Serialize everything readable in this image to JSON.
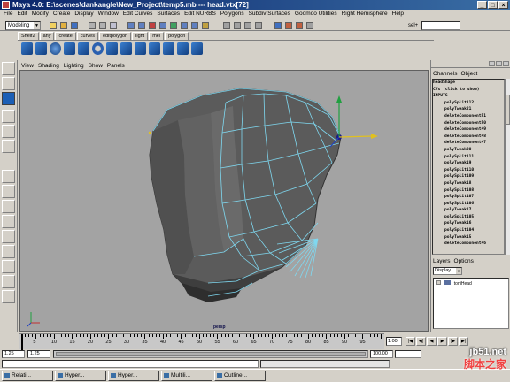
{
  "title": "Maya 4.0: E:\\scenes\\dankangle\\New_Project\\temp5.mb  ---  head.vtx[72]",
  "window_buttons": [
    "_",
    "□",
    "×"
  ],
  "menubar": [
    "File",
    "Edit",
    "Modify",
    "Create",
    "Display",
    "Window",
    "Edit Curves",
    "Surfaces",
    "Edit NURBS",
    "Polygons",
    "Subdiv Surfaces",
    "Goomoo Utilities",
    "Right Hemisphere",
    "Help"
  ],
  "status_line": {
    "mode": "Modeling",
    "selection_label": "sel+"
  },
  "shelf_tabs": [
    "Shelf2",
    "any",
    "create",
    "curves",
    "editpolygon",
    "light",
    "mel",
    "polygon"
  ],
  "panel_menu": [
    "View",
    "Shading",
    "Lighting",
    "Show",
    "Panels"
  ],
  "viewport": {
    "label": "persp"
  },
  "channel_box": {
    "menu": [
      "Channels",
      "Object"
    ],
    "rows": [
      {
        "text": "headShape",
        "indent": false
      },
      {
        "text": "CVs (click to show)",
        "indent": false
      },
      {
        "text": "INPUTS",
        "indent": false
      },
      {
        "text": "polySplit112",
        "indent": true
      },
      {
        "text": "polyTweak21",
        "indent": true
      },
      {
        "text": "deleteComponent51",
        "indent": true
      },
      {
        "text": "deleteComponent50",
        "indent": true
      },
      {
        "text": "deleteComponent49",
        "indent": true
      },
      {
        "text": "deleteComponent48",
        "indent": true
      },
      {
        "text": "deleteComponent47",
        "indent": true
      },
      {
        "text": "polyTweak20",
        "indent": true
      },
      {
        "text": "polySplit111",
        "indent": true
      },
      {
        "text": "polyTweak19",
        "indent": true
      },
      {
        "text": "polySplit110",
        "indent": true
      },
      {
        "text": "polySplit109",
        "indent": true
      },
      {
        "text": "polyTweak18",
        "indent": true
      },
      {
        "text": "polySplit108",
        "indent": true
      },
      {
        "text": "polySplit107",
        "indent": true
      },
      {
        "text": "polySplit106",
        "indent": true
      },
      {
        "text": "polyTweak17",
        "indent": true
      },
      {
        "text": "polySplit105",
        "indent": true
      },
      {
        "text": "polyTweak16",
        "indent": true
      },
      {
        "text": "polySplit104",
        "indent": true
      },
      {
        "text": "polyTweak15",
        "indent": true
      },
      {
        "text": "deleteComponent46",
        "indent": true
      }
    ]
  },
  "layer_editor": {
    "menu": [
      "Layers",
      "Options"
    ],
    "display_mode": "Display",
    "layers": [
      {
        "name": "toniHead"
      }
    ]
  },
  "time_slider": {
    "labels": [
      "5",
      "10",
      "15",
      "20",
      "25",
      "30",
      "35",
      "40",
      "45",
      "50",
      "55",
      "60",
      "65",
      "70",
      "75",
      "80",
      "85",
      "90",
      "95"
    ],
    "start": 1,
    "end": 100,
    "current": 1
  },
  "current_time": "1.00",
  "playback_buttons": [
    "|◀",
    "◀|",
    "◀",
    "▶",
    "|▶",
    "▶|"
  ],
  "range": {
    "start": "1.25",
    "start_inner": "1.25",
    "end_inner": "100.00",
    "end": ""
  },
  "taskbar": [
    "Relati...",
    "Hyper...",
    "Hyper...",
    "Multili...",
    "Outline..."
  ],
  "watermark": {
    "line1": "jb51.net",
    "line2": "脚本之家"
  },
  "colors": {
    "titlebar": "#0a246a",
    "viewport_bg": "#a3a3a3",
    "mesh_fill": "#5b5b5b",
    "wire": "#7fd8f0",
    "accent_active": "#1c5fb5"
  }
}
